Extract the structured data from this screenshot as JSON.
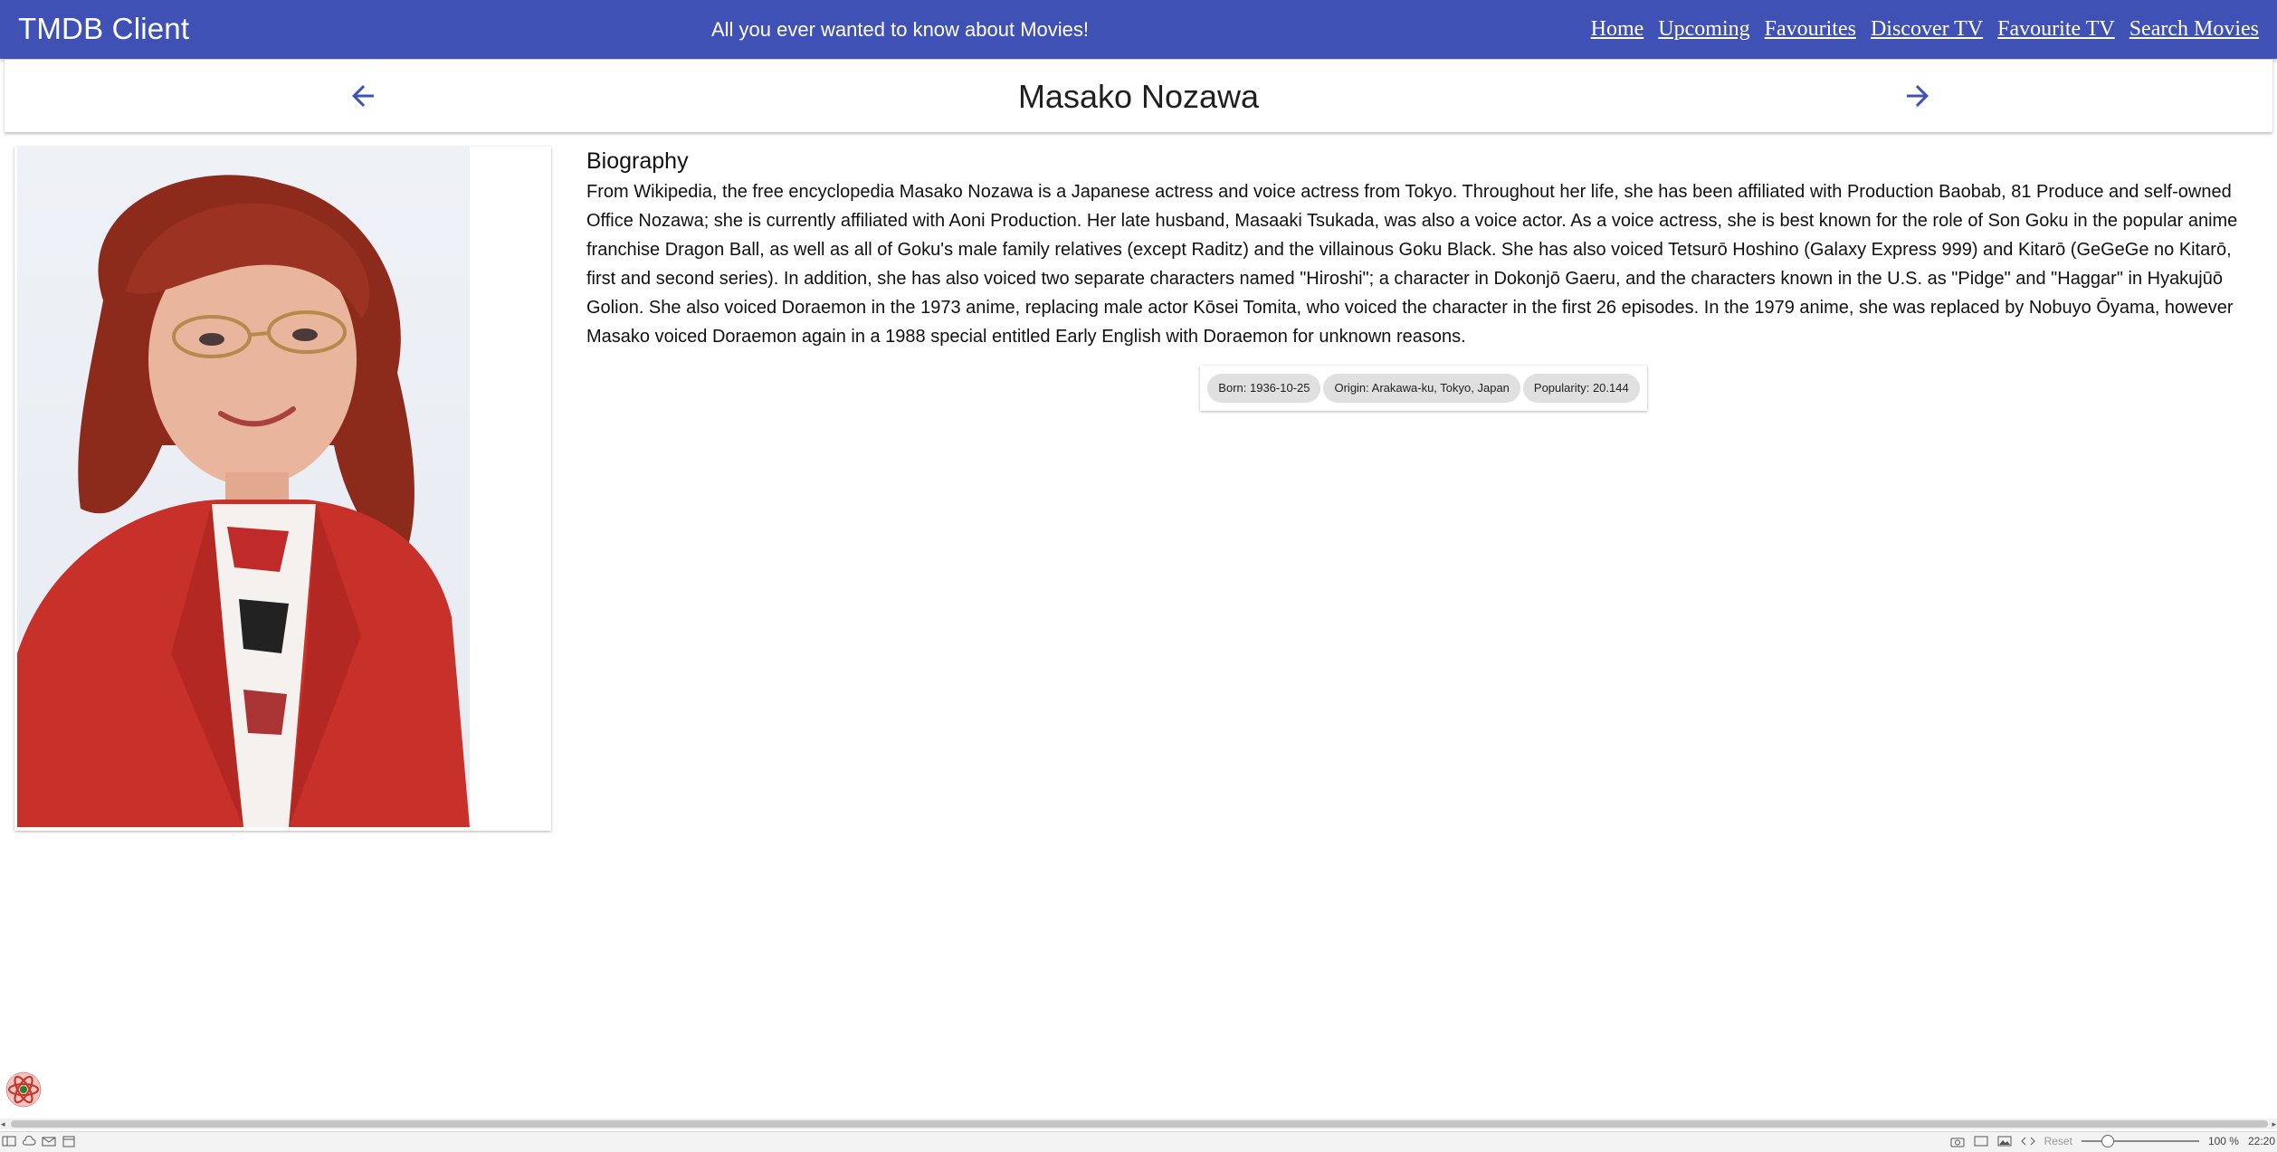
{
  "appbar": {
    "title": "TMDB Client",
    "tagline": "All you ever wanted to know about Movies!",
    "nav": [
      "Home",
      "Upcoming",
      "Favourites",
      "Discover TV",
      "Favourite TV",
      "Search Movies"
    ],
    "color": "#3f51b5"
  },
  "header": {
    "name": "Masako Nozawa",
    "back_icon": "arrow-left-icon",
    "forward_icon": "arrow-right-icon"
  },
  "profile": {
    "photo_icon": "person-photo"
  },
  "biography": {
    "heading": "Biography",
    "text": "From Wikipedia, the free encyclopedia Masako Nozawa is a Japanese actress and voice actress from Tokyo. Throughout her life, she has been affiliated with Production Baobab, 81 Produce and self-owned Office Nozawa; she is currently affiliated with Aoni Production. Her late husband, Masaaki Tsukada, was also a voice actor. As a voice actress, she is best known for the role of Son Goku in the popular anime franchise Dragon Ball, as well as all of Goku's male family relatives (except Raditz) and the villainous Goku Black. She has also voiced Tetsurō Hoshino (Galaxy Express 999) and Kitarō (GeGeGe no Kitarō, first and second series). In addition, she has also voiced two separate characters named \"Hiroshi\"; a character in Dokonjō Gaeru, and the characters known in the U.S. as \"Pidge\" and \"Haggar\" in Hyakujūō Golion. She also voiced Doraemon in the 1973 anime, replacing male actor Kōsei Tomita, who voiced the character in the first 26 episodes. In the 1979 anime, she was replaced by Nobuyo Ōyama, however Masako voiced Doraemon again in a 1988 special entitled Early English with Doraemon for unknown reasons."
  },
  "chips": {
    "born": "Born: 1936-10-25",
    "origin": "Origin: Arakawa-ku, Tokyo, Japan",
    "popularity": "Popularity: 20.144"
  },
  "statusbar": {
    "reset": "Reset",
    "zoom": "100 %",
    "time": "22:20"
  }
}
